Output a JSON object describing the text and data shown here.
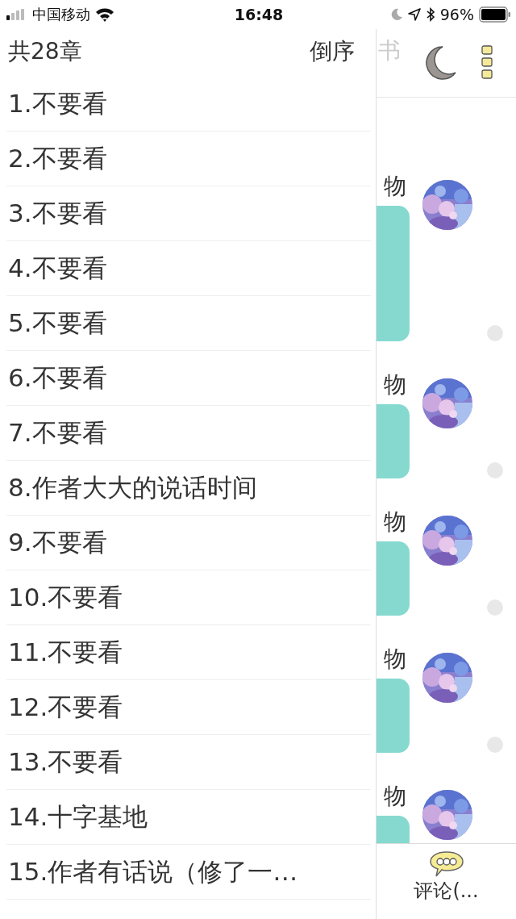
{
  "status_bar": {
    "carrier": "中国移动",
    "time": "16:48",
    "battery": "96%"
  },
  "drawer": {
    "count": "共28章",
    "sort_button": "倒序",
    "chapters": [
      "1.不要看",
      "2.不要看",
      "3.不要看",
      "4.不要看",
      "5.不要看",
      "6.不要看",
      "7.不要看",
      "8.作者大大的说话时间",
      "9.不要看",
      "10.不要看",
      "11.不要看",
      "12.不要看",
      "13.不要看",
      "14.十字基地",
      "15.作者有话说（修了一…"
    ]
  },
  "page": {
    "header_title": "书",
    "messages": [
      {
        "name": "物"
      },
      {
        "name": "物"
      },
      {
        "name": "物"
      },
      {
        "name": "物"
      },
      {
        "name": "物"
      }
    ],
    "comment_button": "评论(..."
  }
}
